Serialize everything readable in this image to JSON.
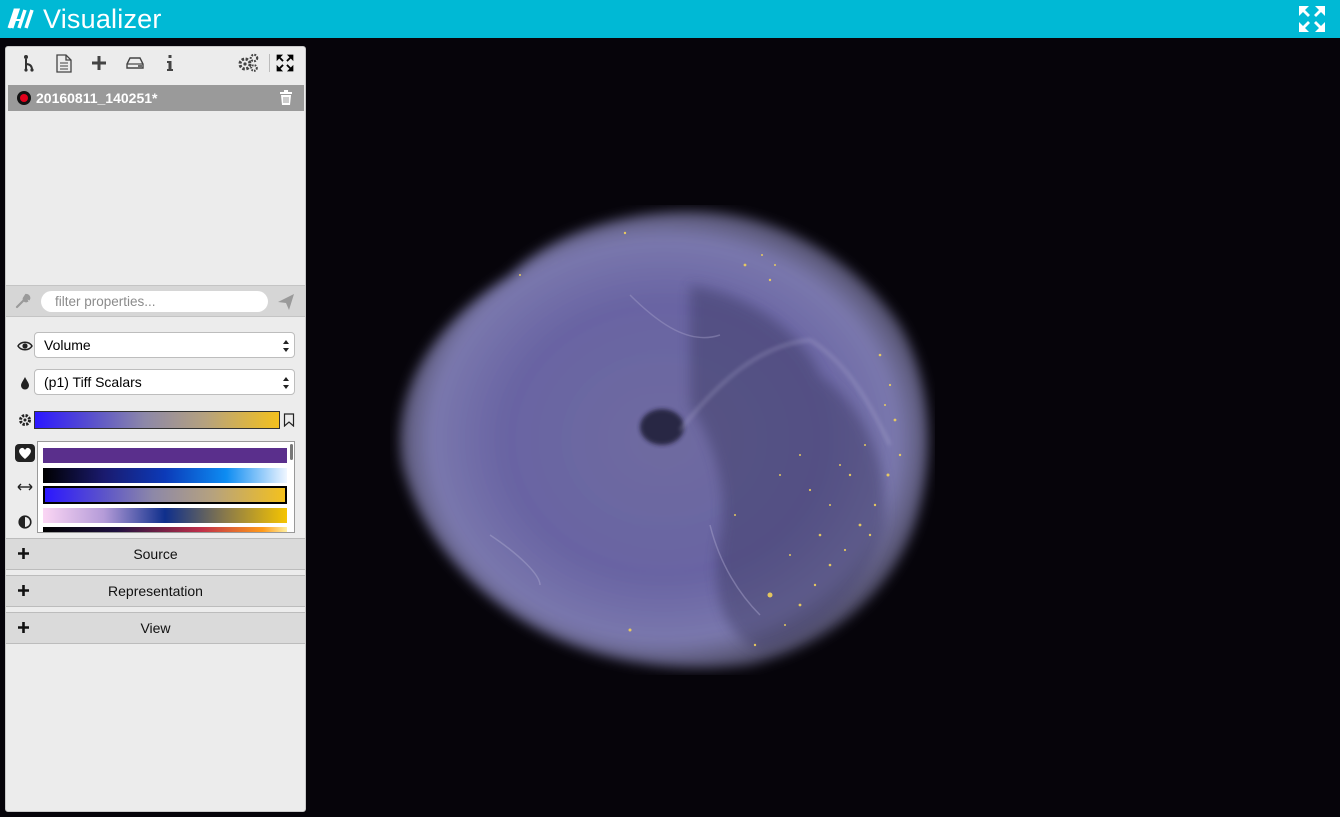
{
  "app": {
    "title": "Visualizer"
  },
  "pipeline": {
    "items": [
      {
        "name": "20160811_140251*"
      }
    ]
  },
  "filter": {
    "placeholder": "filter properties..."
  },
  "properties": {
    "representation": "Volume",
    "color_by": "(p1) Tiff Scalars",
    "colormap_presets": [
      "Purple",
      "Blue - Black",
      "Blue - Gold",
      "Pink - Gold",
      "Black - Orange"
    ]
  },
  "sections": [
    {
      "label": "Source"
    },
    {
      "label": "Representation"
    },
    {
      "label": "View"
    }
  ],
  "colors": {
    "header": "#00b9d5",
    "background": "#06040a",
    "panel": "#ececec",
    "selected_item": "#9a9a9a",
    "record": "#e1001b"
  },
  "icons": [
    "logo-icon",
    "fullscreen-icon",
    "pipeline-icon",
    "document-icon",
    "plus-icon",
    "drive-icon",
    "info-icon",
    "settings-icon",
    "trash-icon",
    "wrench-icon",
    "send-icon",
    "eye-icon",
    "drop-icon",
    "gear-icon",
    "heart-icon",
    "range-icon",
    "contrast-icon",
    "bookmark-icon"
  ]
}
